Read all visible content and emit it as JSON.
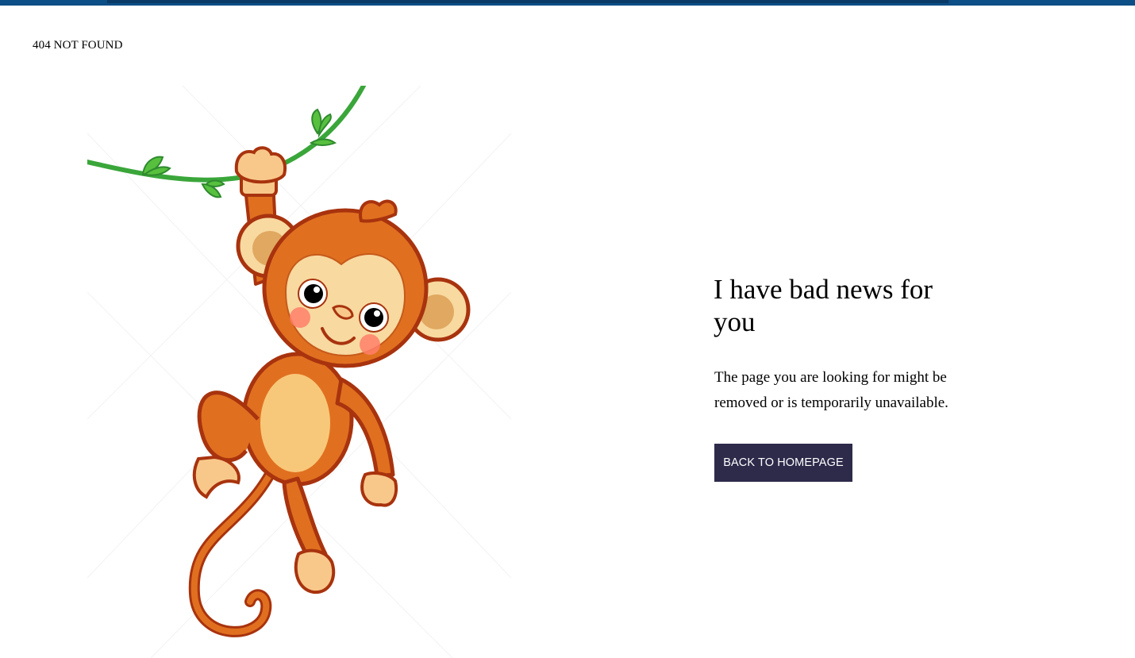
{
  "page": {
    "error_code": "404 NOT FOUND",
    "headline": "I have bad news for you",
    "message": "The page you are looking for might be removed or is temporarily unavailable.",
    "button_label": "BACK TO HOMEPAGE"
  },
  "illustration": {
    "subject": "cartoon monkey hanging from a vine",
    "icon": "monkey-illustration"
  },
  "colors": {
    "top_bar": "#0c4e86",
    "button_bg": "#2d2a4a",
    "button_text": "#ffffff",
    "monkey_fur": "#e07020",
    "monkey_outline": "#a8330e",
    "monkey_face": "#f8d9a0",
    "vine": "#3aa63a"
  }
}
